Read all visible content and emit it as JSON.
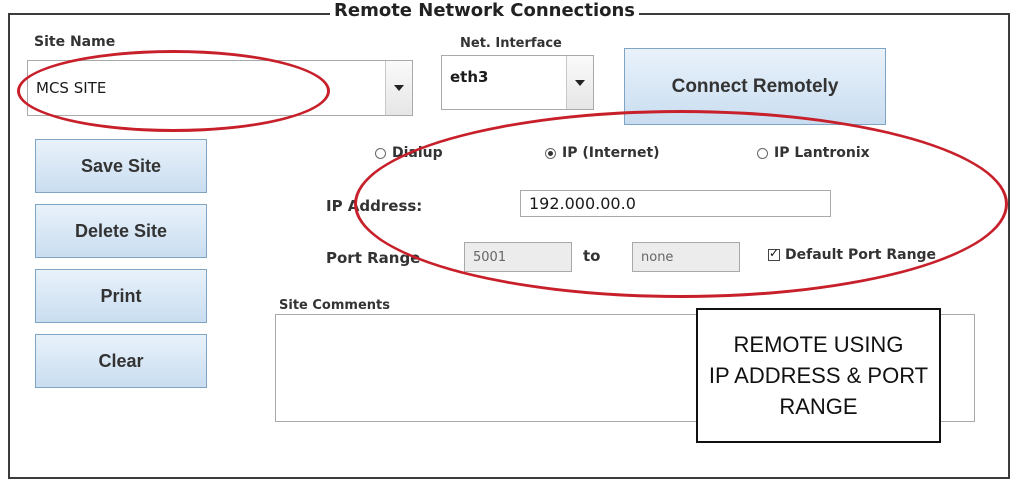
{
  "panel": {
    "title": "Remote Network Connections"
  },
  "site": {
    "label": "Site Name",
    "value": "MCS SITE"
  },
  "net_interface": {
    "label": "Net. Interface",
    "value": "eth3"
  },
  "buttons": {
    "connect": "Connect Remotely",
    "save": "Save Site",
    "delete": "Delete Site",
    "print": "Print",
    "clear": "Clear"
  },
  "connection_type": {
    "options": [
      {
        "label": "Dialup",
        "selected": false
      },
      {
        "label": "IP (Internet)",
        "selected": true
      },
      {
        "label": "IP Lantronix",
        "selected": false
      }
    ]
  },
  "ip": {
    "label": "IP Address:",
    "value": "192.000.00.0"
  },
  "port": {
    "label": "Port Range",
    "from": "5001",
    "to_label": "to",
    "to": "none",
    "default_label": "Default Port Range",
    "default_checked": true
  },
  "comments": {
    "label": "Site Comments",
    "value": ""
  },
  "annotation": {
    "line1": "REMOTE USING",
    "line2": "IP ADDRESS & PORT",
    "line3": "RANGE",
    "highlight_color": "#c8202b"
  }
}
